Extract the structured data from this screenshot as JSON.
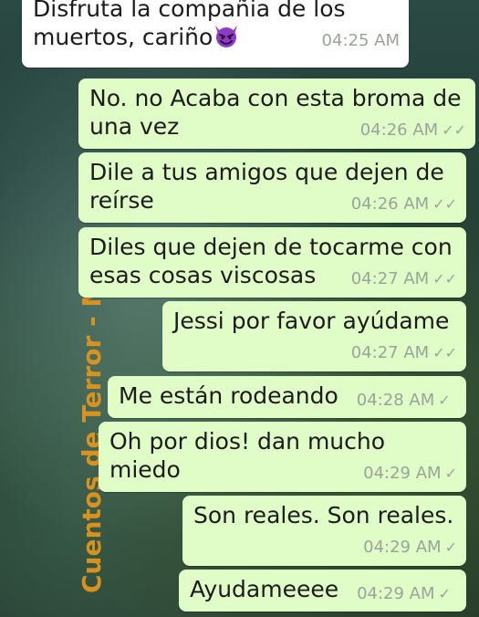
{
  "watermark": "Cuentos de Terror - Ma",
  "messages": [
    {
      "direction": "in",
      "text": "Disfruta la compañia de los muertos, cariño",
      "emoji": "devil-face-icon",
      "time": "04:25 AM",
      "ticks": ""
    },
    {
      "direction": "out",
      "text": "No. no Acaba con esta broma de una vez",
      "time": "04:26 AM",
      "ticks": "double"
    },
    {
      "direction": "out",
      "text": "Dile a tus amigos que dejen de reírse",
      "time": "04:26 AM",
      "ticks": "double"
    },
    {
      "direction": "out",
      "text": "Diles que dejen de tocarme con esas cosas viscosas",
      "time": "04:27 AM",
      "ticks": "double"
    },
    {
      "direction": "out",
      "text": "Jessi por favor ayúdame",
      "time": "04:27 AM",
      "ticks": "double"
    },
    {
      "direction": "out",
      "text": "Me están rodeando",
      "time": "04:28 AM",
      "ticks": "single"
    },
    {
      "direction": "out",
      "text": "Oh por dios! dan mucho miedo",
      "time": "04:29 AM",
      "ticks": "single"
    },
    {
      "direction": "out",
      "text": "Son reales. Son reales.",
      "time": "04:29 AM",
      "ticks": "single"
    },
    {
      "direction": "out",
      "text": "Ayudameeee",
      "time": "04:29 AM",
      "ticks": "single"
    }
  ],
  "colors": {
    "incoming_bubble": "#ffffff",
    "outgoing_bubble": "#e1fdc7",
    "timestamp": "#9aa39a",
    "watermark": "#e0951d"
  }
}
